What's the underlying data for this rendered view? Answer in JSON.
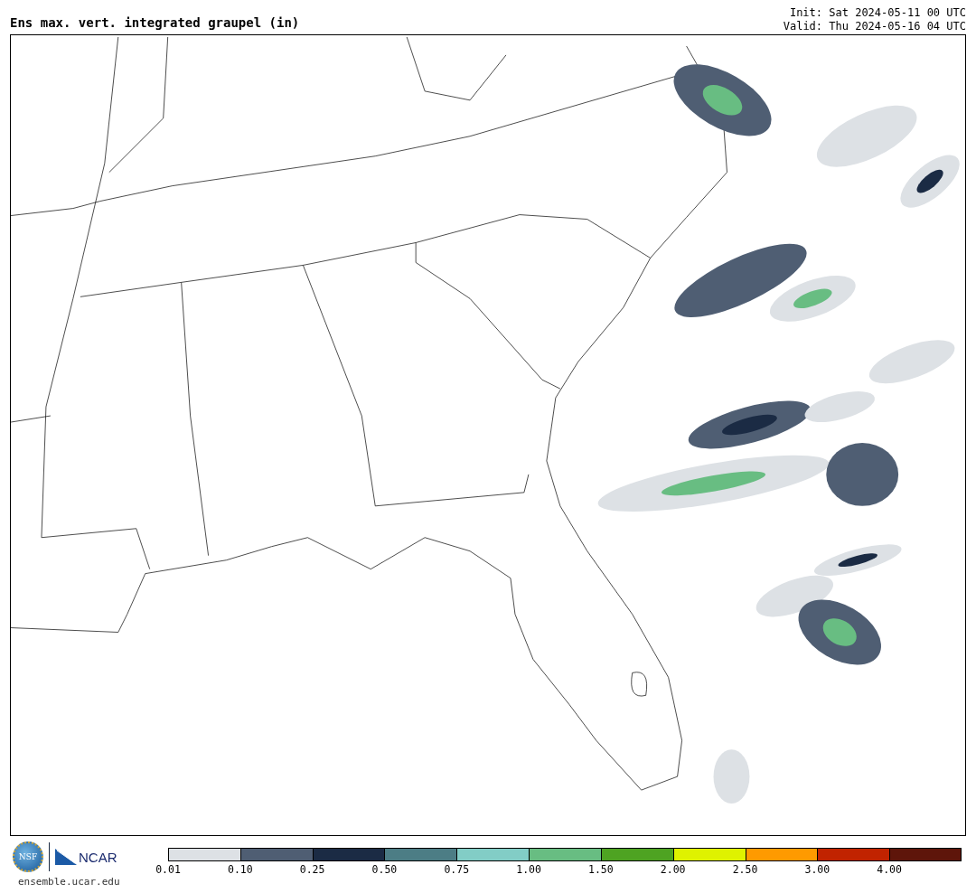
{
  "title": "Ens max. vert. integrated graupel (in)",
  "init": "Init: Sat 2024-05-11 00 UTC",
  "valid": "Valid: Thu 2024-05-16 04 UTC",
  "logos": {
    "nsf": "NSF",
    "ncar": "NCAR"
  },
  "site": "ensemble.ucar.edu",
  "colorbar": [
    {
      "label": "0.01",
      "color": "#dde1e5"
    },
    {
      "label": "0.10",
      "color": "#4f5e73"
    },
    {
      "label": "0.25",
      "color": "#1b2b44"
    },
    {
      "label": "0.50",
      "color": "#4c7d85"
    },
    {
      "label": "0.75",
      "color": "#82cdc6"
    },
    {
      "label": "1.00",
      "color": "#68bd82"
    },
    {
      "label": "1.50",
      "color": "#4ea322"
    },
    {
      "label": "2.00",
      "color": "#dff200"
    },
    {
      "label": "2.50",
      "color": "#fe9a00"
    },
    {
      "label": "3.00",
      "color": "#c12300"
    },
    {
      "label": "4.00",
      "color": "#5e150a"
    }
  ]
}
